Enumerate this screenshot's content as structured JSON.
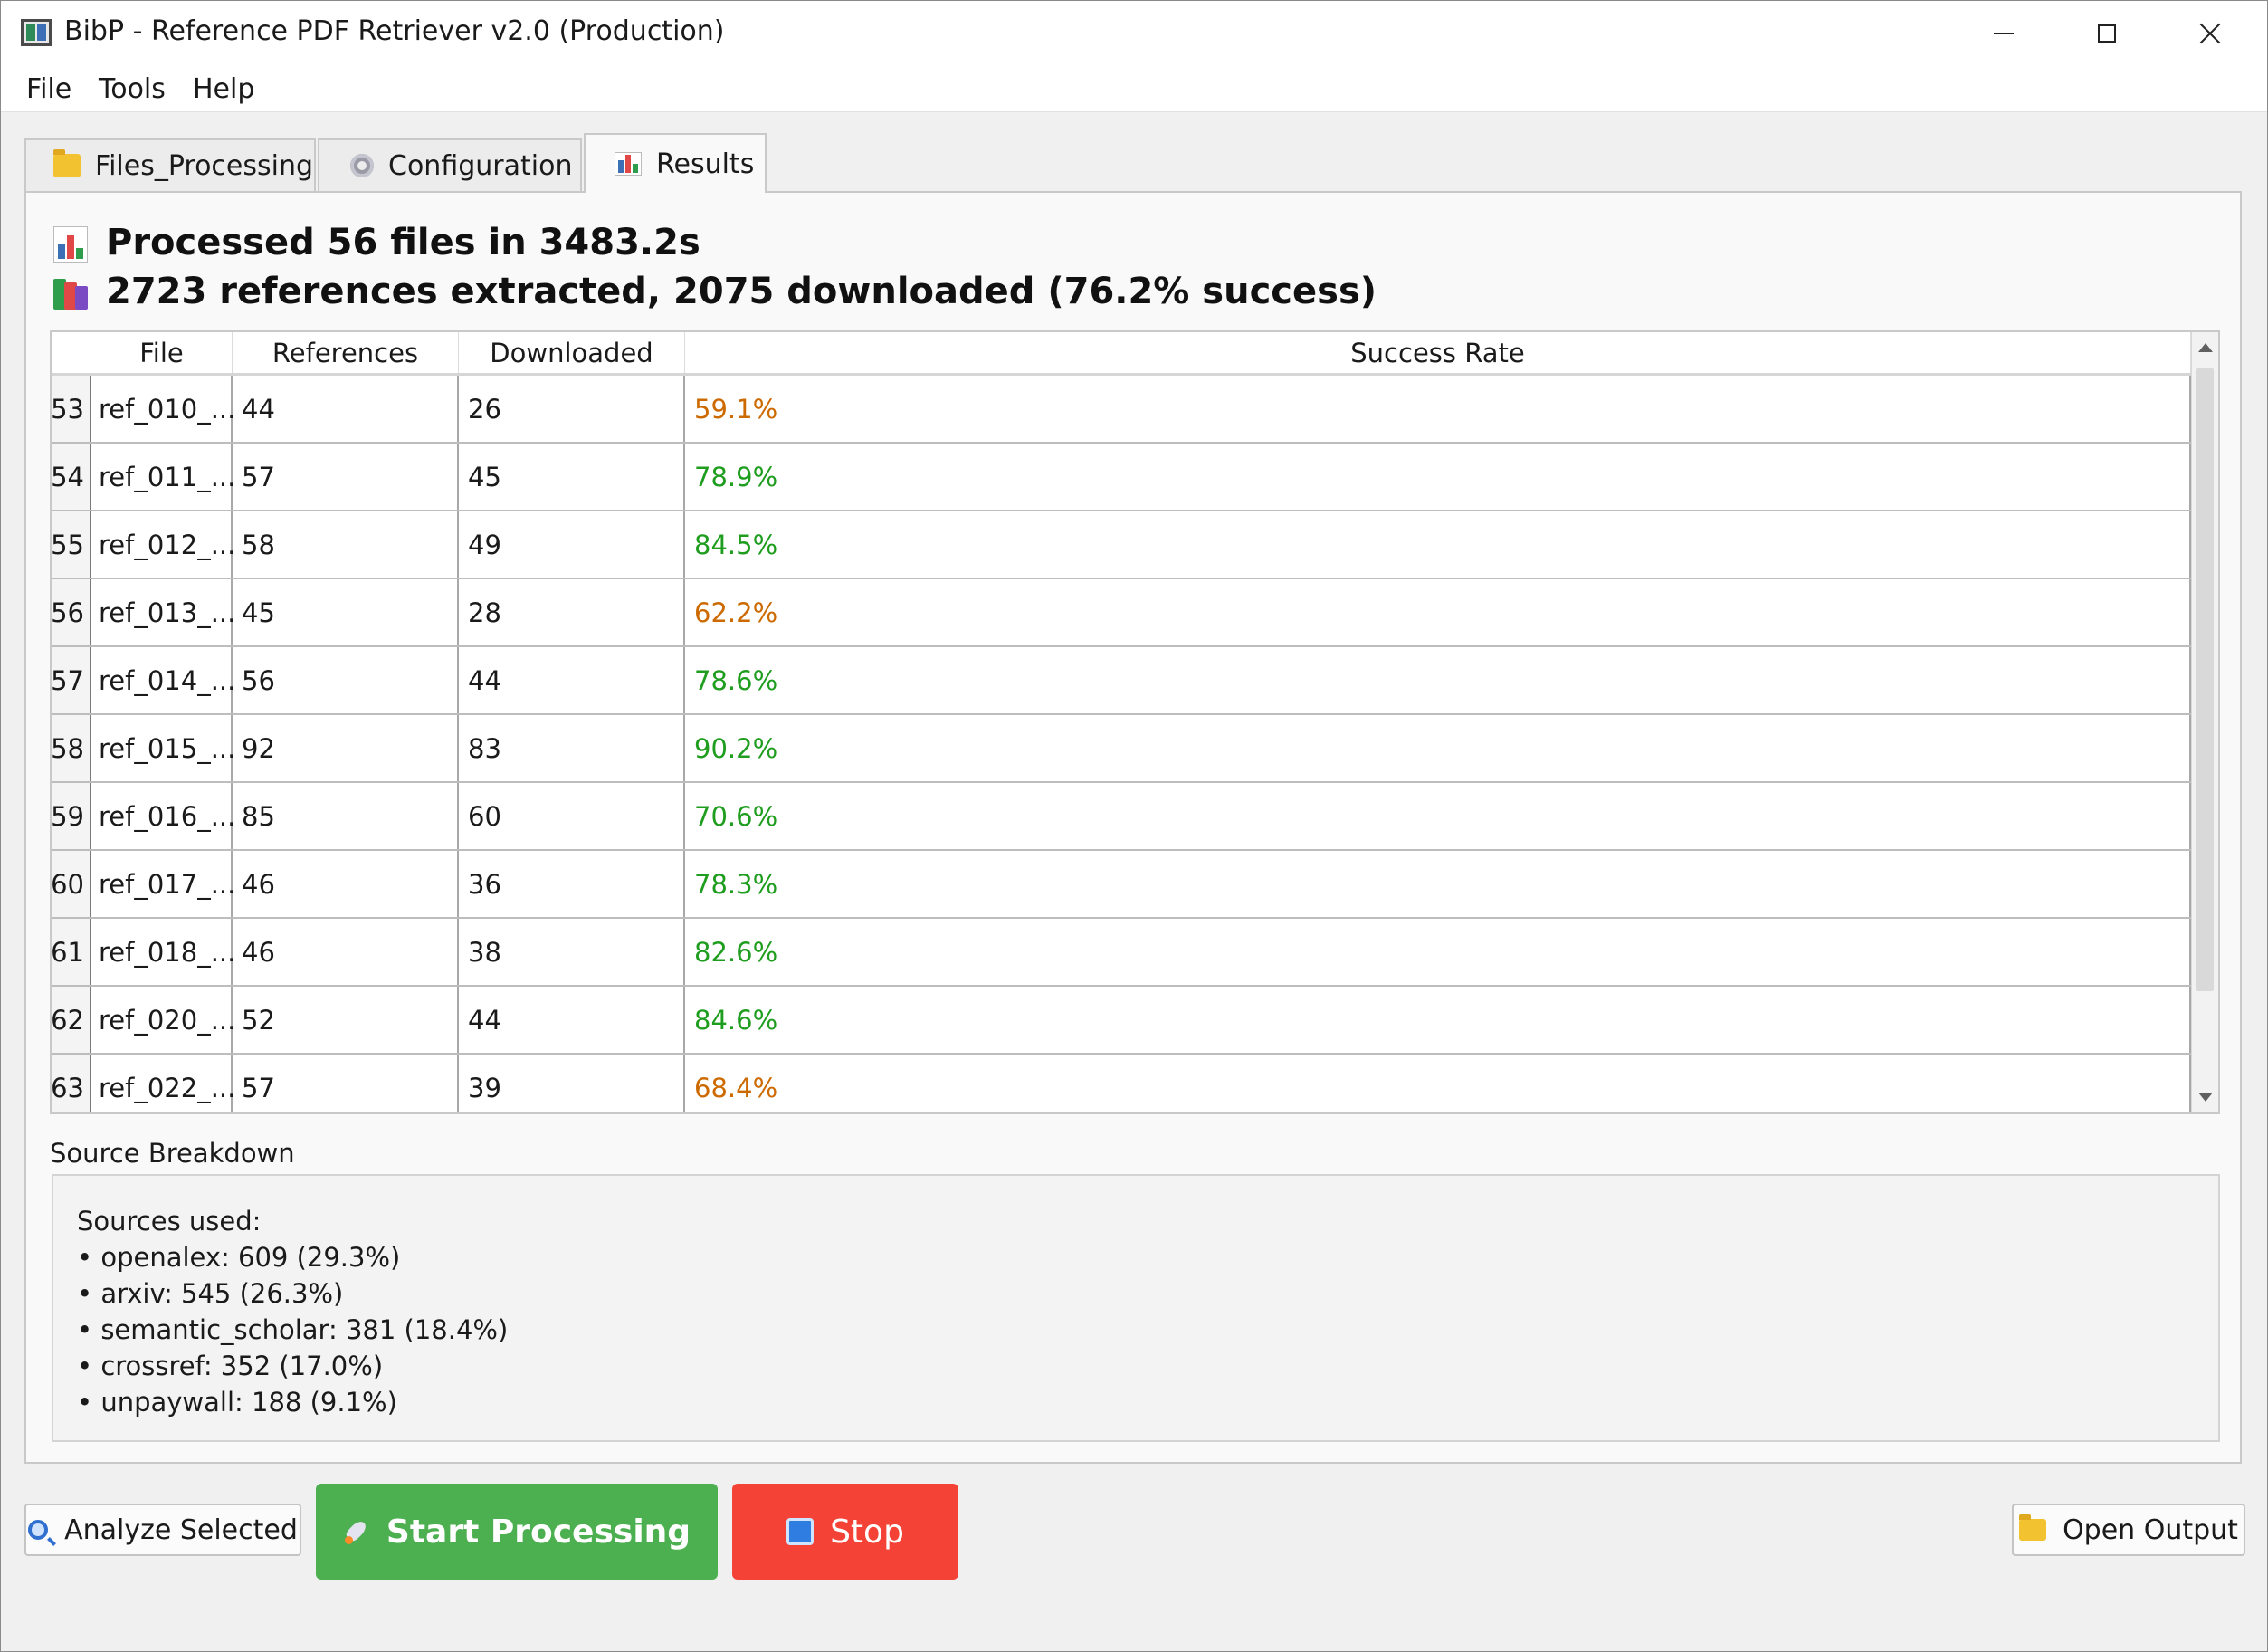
{
  "window": {
    "title": "BibP - Reference PDF Retriever v2.0 (Production)"
  },
  "menu": [
    "File",
    "Tools",
    "Help"
  ],
  "tabs": [
    {
      "label": "Files_Processing",
      "icon": "folder-icon",
      "active": false
    },
    {
      "label": "Configuration",
      "icon": "gear-icon",
      "active": false
    },
    {
      "label": "Results",
      "icon": "bar-chart-icon",
      "active": true
    }
  ],
  "summary": {
    "line1": "Processed 56 files in 3483.2s",
    "line2": "2723 references extracted, 2075 downloaded (76.2% success)"
  },
  "table": {
    "headers": [
      "File",
      "References",
      "Downloaded",
      "Success Rate"
    ],
    "rows": [
      {
        "index": "53",
        "file": "ref_010_...",
        "references": "44",
        "downloaded": "26",
        "rate": "59.1%",
        "status": "warn"
      },
      {
        "index": "54",
        "file": "ref_011_...",
        "references": "57",
        "downloaded": "45",
        "rate": "78.9%",
        "status": "good"
      },
      {
        "index": "55",
        "file": "ref_012_...",
        "references": "58",
        "downloaded": "49",
        "rate": "84.5%",
        "status": "good"
      },
      {
        "index": "56",
        "file": "ref_013_...",
        "references": "45",
        "downloaded": "28",
        "rate": "62.2%",
        "status": "warn"
      },
      {
        "index": "57",
        "file": "ref_014_...",
        "references": "56",
        "downloaded": "44",
        "rate": "78.6%",
        "status": "good"
      },
      {
        "index": "58",
        "file": "ref_015_...",
        "references": "92",
        "downloaded": "83",
        "rate": "90.2%",
        "status": "good"
      },
      {
        "index": "59",
        "file": "ref_016_...",
        "references": "85",
        "downloaded": "60",
        "rate": "70.6%",
        "status": "good"
      },
      {
        "index": "60",
        "file": "ref_017_...",
        "references": "46",
        "downloaded": "36",
        "rate": "78.3%",
        "status": "good"
      },
      {
        "index": "61",
        "file": "ref_018_...",
        "references": "46",
        "downloaded": "38",
        "rate": "82.6%",
        "status": "good"
      },
      {
        "index": "62",
        "file": "ref_020_...",
        "references": "52",
        "downloaded": "44",
        "rate": "84.6%",
        "status": "good"
      },
      {
        "index": "63",
        "file": "ref_022_...",
        "references": "57",
        "downloaded": "39",
        "rate": "68.4%",
        "status": "warn"
      }
    ]
  },
  "breakdown": {
    "label": "Source Breakdown",
    "heading": "Sources used:",
    "items": [
      "• openalex: 609 (29.3%)",
      "• arxiv: 545 (26.3%)",
      "• semantic_scholar: 381 (18.4%)",
      "• crossref: 352 (17.0%)",
      "• unpaywall: 188 (9.1%)"
    ]
  },
  "buttons": {
    "analyze": "Analyze Selected",
    "start": "Start Processing",
    "stop": "Stop",
    "open_output": "Open Output"
  },
  "colors": {
    "good": "#1f9d1f",
    "warn": "#cc6a00",
    "start_button": "#4caf50",
    "stop_button": "#f44336"
  }
}
